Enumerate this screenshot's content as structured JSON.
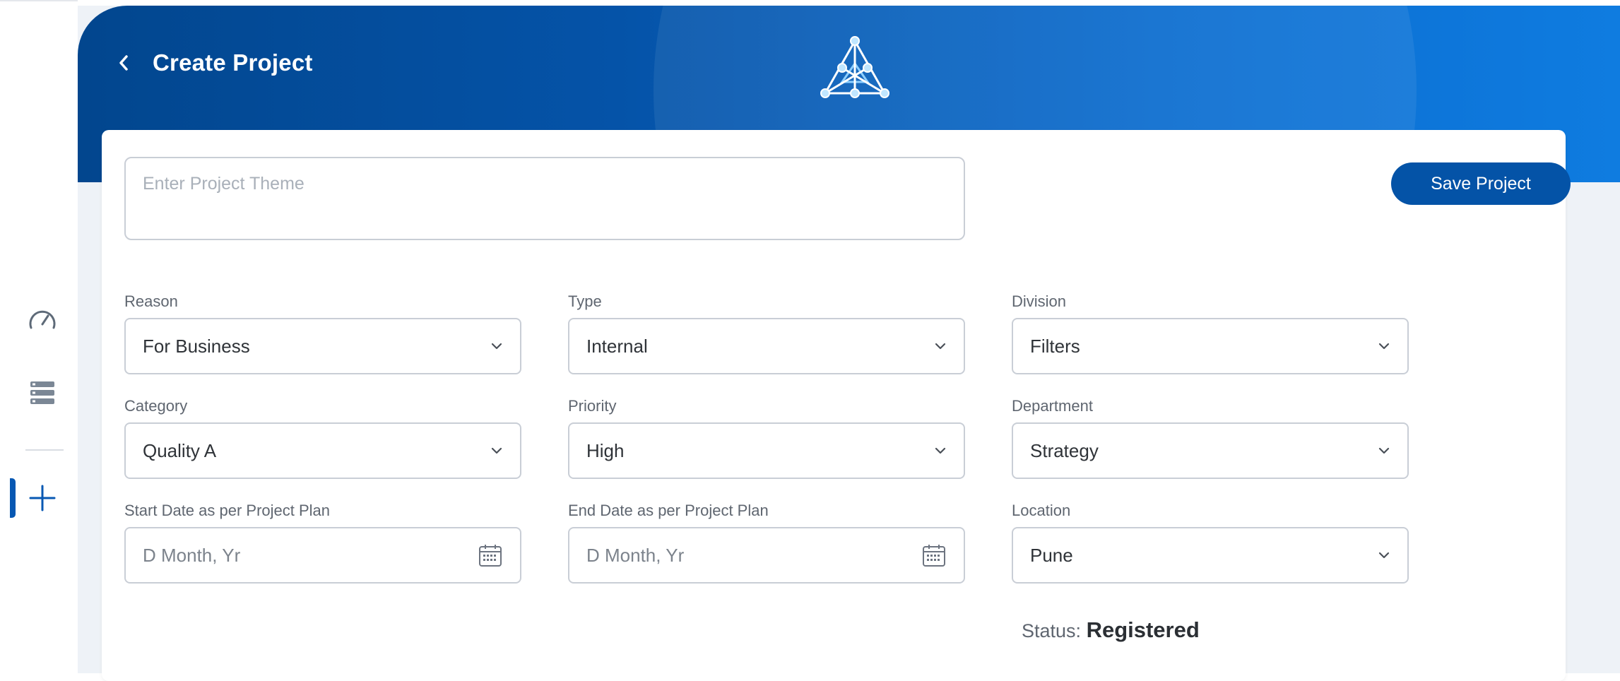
{
  "header": {
    "title": "Create Project"
  },
  "theme": {
    "placeholder": "Enter Project Theme",
    "value": ""
  },
  "actions": {
    "save_label": "Save Project"
  },
  "fields": {
    "reason": {
      "label": "Reason",
      "value": "For Business"
    },
    "type": {
      "label": "Type",
      "value": "Internal"
    },
    "division": {
      "label": "Division",
      "value": "Filters"
    },
    "category": {
      "label": "Category",
      "value": "Quality A"
    },
    "priority": {
      "label": "Priority",
      "value": "High"
    },
    "department": {
      "label": "Department",
      "value": "Strategy"
    },
    "start_date": {
      "label": "Start Date as per Project Plan",
      "placeholder": "D Month, Yr"
    },
    "end_date": {
      "label": "End Date as per Project Plan",
      "placeholder": "D Month, Yr"
    },
    "location": {
      "label": "Location",
      "value": "Pune"
    }
  },
  "status": {
    "label": "Status:",
    "value": "Registered"
  },
  "icons": {
    "rail": [
      "speedometer-icon",
      "list-icon",
      "plus-icon"
    ],
    "dropdown": "chevron-down-icon",
    "date": "calendar-icon",
    "back": "chevron-left-icon"
  },
  "colors": {
    "primary": "#0453a7",
    "banner_start": "#02468e",
    "banner_end": "#0f7ce0",
    "border": "#c9ced6"
  }
}
